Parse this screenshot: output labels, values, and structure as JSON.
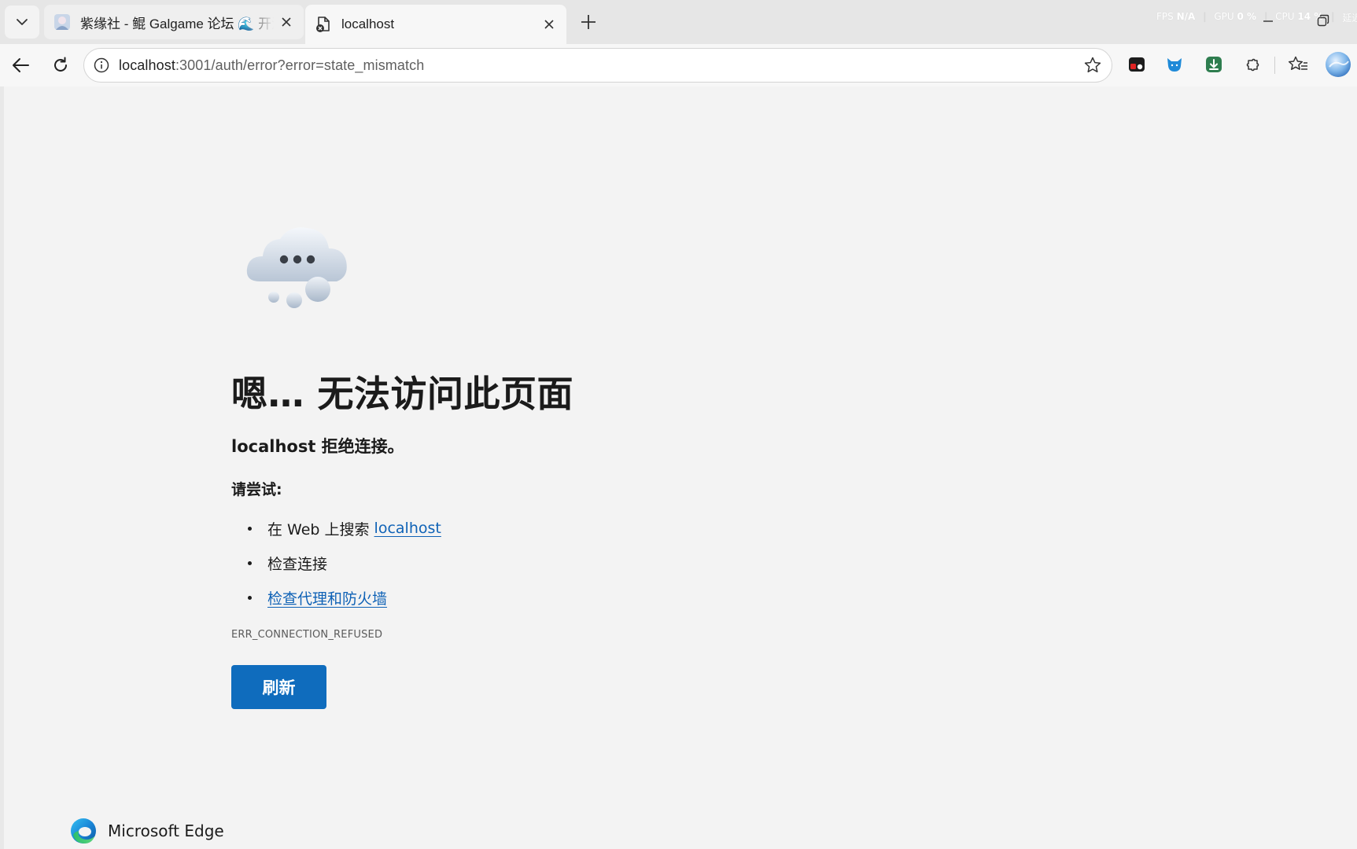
{
  "browser": {
    "tabs": [
      {
        "title": "紫缘社 - 鲲 Galgame 论坛 🌊 开源",
        "favicon": "forum-avatar-icon",
        "active": false
      },
      {
        "title": "localhost",
        "favicon": "page-error-icon",
        "active": true
      }
    ],
    "perf_overlay": {
      "fps_label": "FPS",
      "fps_value": "N/A",
      "gpu_label": "GPU",
      "gpu_value": "0 %",
      "cpu_label": "CPU",
      "cpu_value": "14 %",
      "extra_label": "延迟"
    },
    "address": {
      "host": "localhost",
      "rest": ":3001/auth/error?error=state_mismatch"
    },
    "extensions": [
      "red-extension-icon",
      "blue-cat-extension-icon",
      "green-download-extension-icon",
      "puzzle-extensions-icon",
      "favorites-icon",
      "profile-avatar-icon"
    ]
  },
  "error_page": {
    "headline": "嗯… 无法访问此页面",
    "subheading": "localhost 拒绝连接。",
    "try_label": "请尝试:",
    "suggestions": {
      "search_prefix": "在 Web 上搜索 ",
      "search_link": "localhost",
      "check_connection": "检查连接",
      "check_proxy": "检查代理和防火墙"
    },
    "error_code": "ERR_CONNECTION_REFUSED",
    "refresh_button": "刷新",
    "brand": "Microsoft Edge"
  },
  "colors": {
    "accent": "#0f6cbd",
    "link": "#0f62b6",
    "page_bg": "#f3f3f3"
  }
}
